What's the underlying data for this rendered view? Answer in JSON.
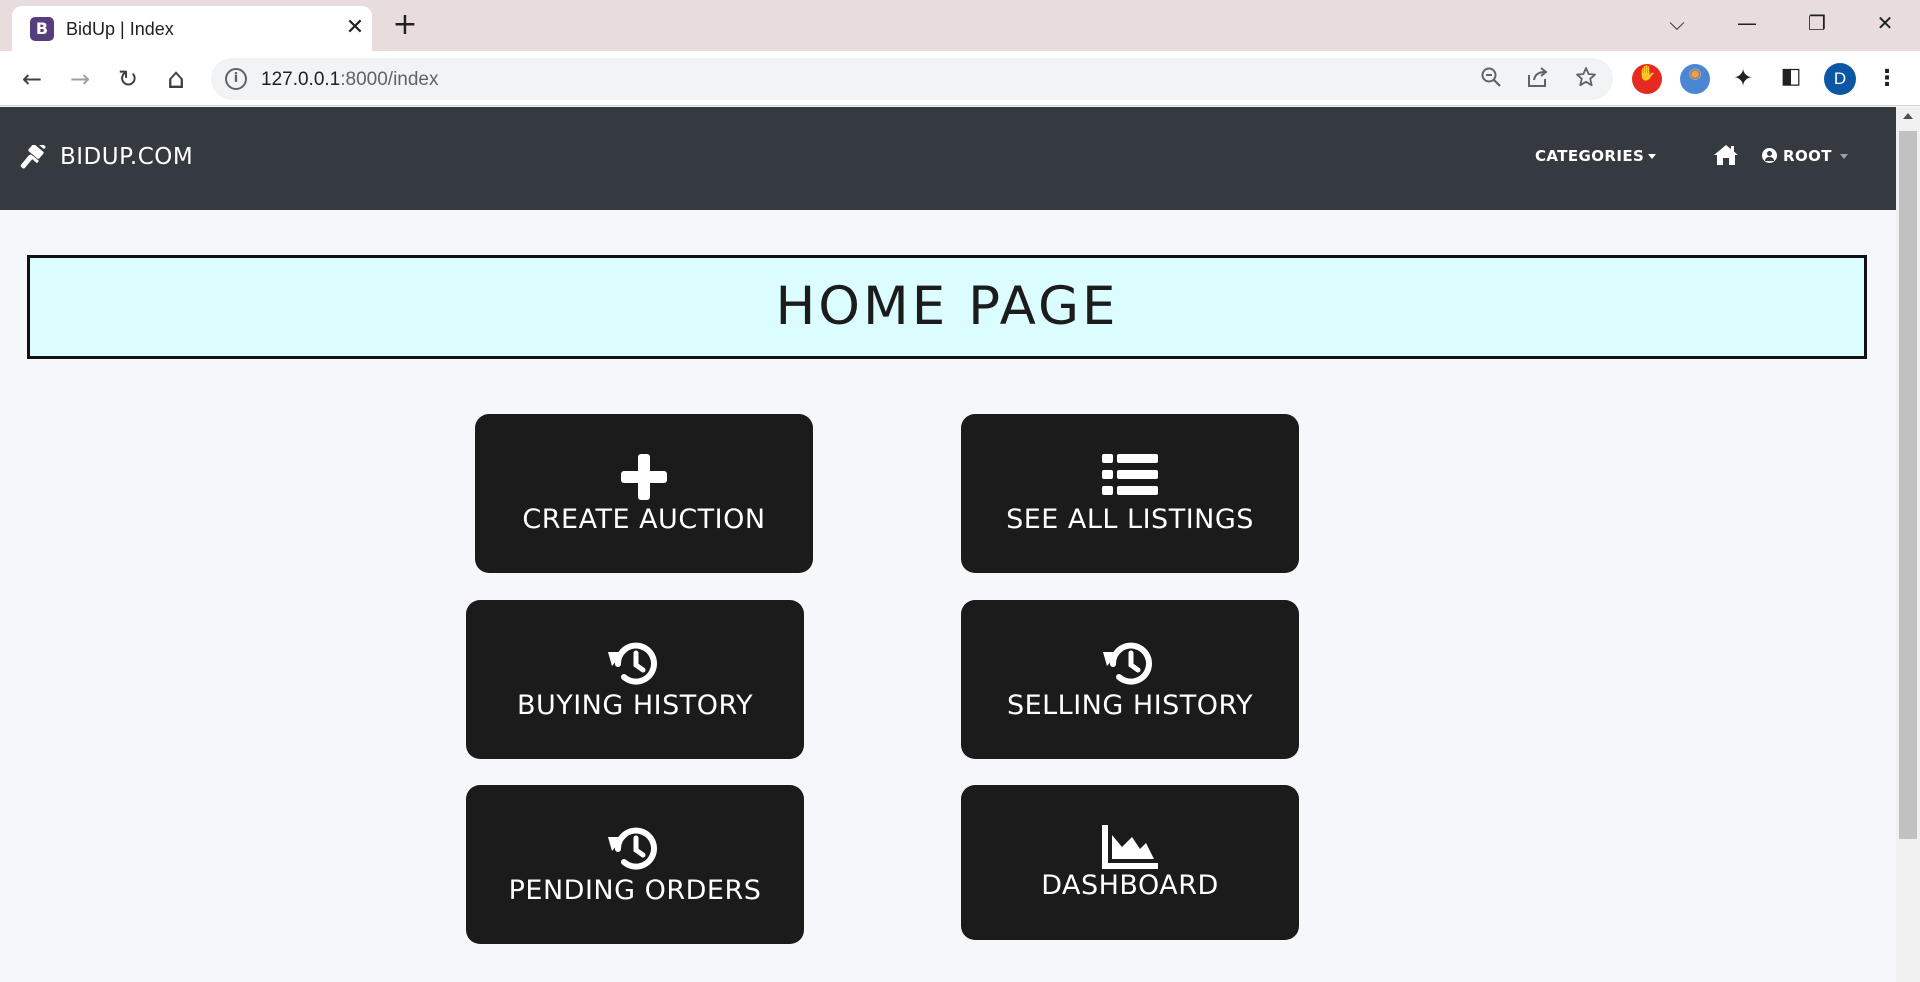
{
  "browser": {
    "tab": {
      "favicon": "B",
      "title": "BidUp | Index",
      "close_glyph": "✕"
    },
    "new_tab_glyph": "+",
    "window_controls": {
      "tab_search": "⌵",
      "minimize": "—",
      "restore": "❐",
      "close": "✕"
    },
    "nav": {
      "back": "←",
      "forward": "→",
      "reload": "↻",
      "home": "⌂"
    },
    "url": {
      "host": "127.0.0.1",
      "rest": ":8000/index"
    },
    "omnibox_icons": {
      "zoom": "zoom-out-icon",
      "share": "share-icon",
      "bookmark": "star-icon"
    },
    "extensions": {
      "red": "✋",
      "blue": "◉",
      "puzzle": "✦",
      "panel": "◧"
    },
    "profile_initial": "D",
    "menu_glyph": "⋮"
  },
  "navbar": {
    "brand": "BIDUP.COM",
    "categories": "CATEGORIES",
    "user": "ROOT",
    "bg_color": "#343a40"
  },
  "page": {
    "heading": "HOME PAGE",
    "heading_bg": "#dbfdff"
  },
  "tiles": {
    "create_auction": {
      "label": "CREATE AUCTION",
      "icon": "plus-icon"
    },
    "see_all_listings": {
      "label": "SEE ALL LISTINGS",
      "icon": "list-icon"
    },
    "buying_history": {
      "label": "BUYING HISTORY",
      "icon": "history-icon"
    },
    "selling_history": {
      "label": "SELLING HISTORY",
      "icon": "history-icon"
    },
    "pending_orders": {
      "label": "PENDING ORDERS",
      "icon": "history-icon"
    },
    "dashboard": {
      "label": "DASHBOARD",
      "icon": "area-chart-icon"
    }
  }
}
